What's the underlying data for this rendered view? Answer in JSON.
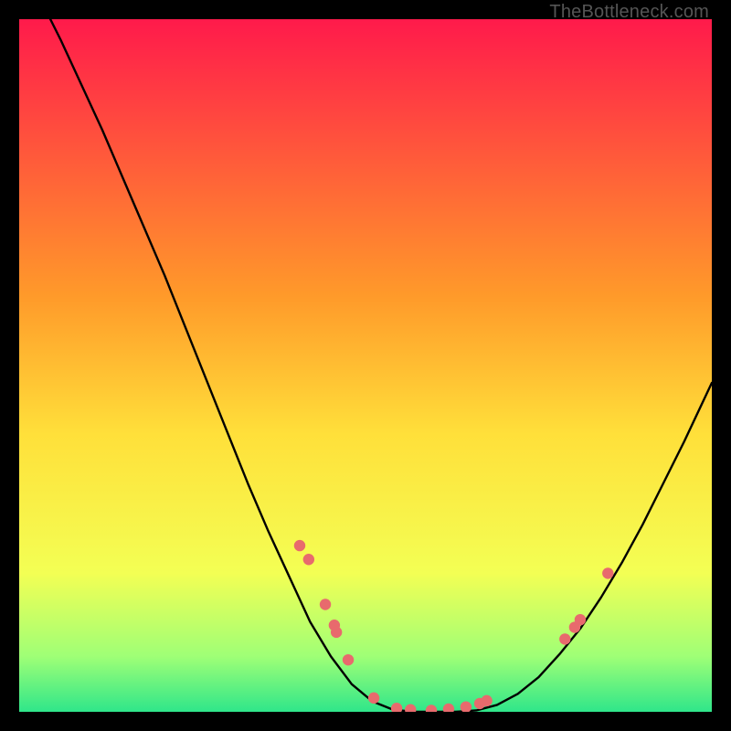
{
  "watermark": "TheBottleneck.com",
  "chart_data": {
    "type": "line",
    "title": "",
    "xlabel": "",
    "ylabel": "",
    "xlim": [
      0,
      100
    ],
    "ylim": [
      0,
      100
    ],
    "grid": false,
    "legend": false,
    "gradient_stops": [
      {
        "offset": 0.0,
        "color": "#ff1a4b"
      },
      {
        "offset": 0.4,
        "color": "#ff9a2a"
      },
      {
        "offset": 0.6,
        "color": "#ffe03a"
      },
      {
        "offset": 0.8,
        "color": "#f3ff54"
      },
      {
        "offset": 0.92,
        "color": "#9fff76"
      },
      {
        "offset": 1.0,
        "color": "#2fe68a"
      }
    ],
    "series": [
      {
        "name": "bottleneck-curve",
        "x": [
          0,
          3,
          6,
          9,
          12,
          15,
          18,
          21,
          24,
          27,
          30,
          33,
          36,
          39,
          42,
          45,
          48,
          51,
          54,
          57,
          60,
          63,
          66,
          69,
          72,
          75,
          78,
          81,
          84,
          87,
          90,
          93,
          96,
          100
        ],
        "y": [
          112,
          103,
          97,
          90.5,
          84,
          77,
          70,
          63,
          55.5,
          48,
          40.5,
          33,
          26,
          19.5,
          13,
          8,
          4,
          1.5,
          0.3,
          0,
          0,
          0,
          0.2,
          1,
          2.6,
          5,
          8.3,
          12,
          16.5,
          21.5,
          27,
          33,
          39,
          47.5
        ]
      }
    ],
    "points": {
      "name": "data-points",
      "color": "#e86a6d",
      "x": [
        40.5,
        41.8,
        44.2,
        45.5,
        45.8,
        47.5,
        51.2,
        54.5,
        56.5,
        59.5,
        62,
        64.5,
        66.5,
        67.5,
        78.8,
        80.2,
        81,
        85
      ],
      "y": [
        24,
        22,
        15.5,
        12.5,
        11.5,
        7.5,
        2,
        0.5,
        0.3,
        0.2,
        0.4,
        0.7,
        1.2,
        1.6,
        10.5,
        12.2,
        13.3,
        20
      ]
    }
  }
}
